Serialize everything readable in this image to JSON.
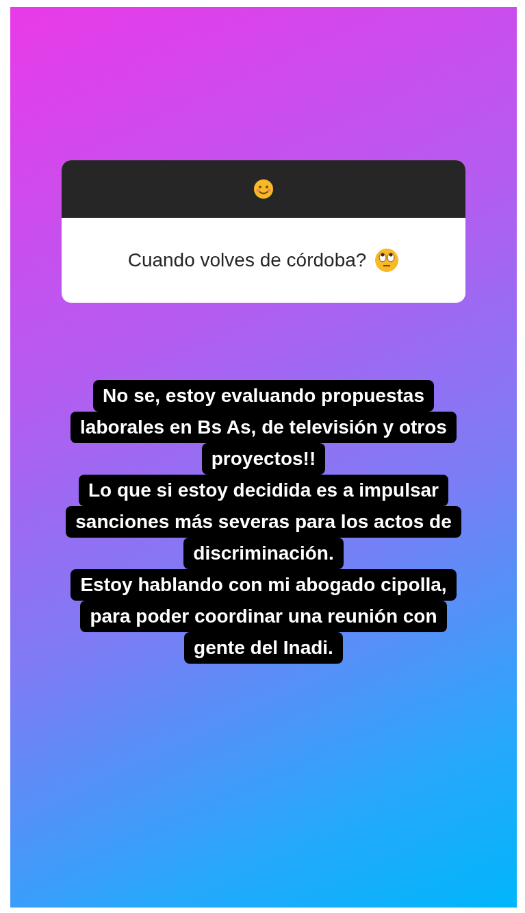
{
  "question_card": {
    "question": "Cuando volves de córdoba?"
  },
  "answer": {
    "paragraphs": [
      {
        "lines": [
          "No se, estoy evaluando propuestas",
          "laborales en Bs As, de televisión y otros",
          "proyectos!!"
        ]
      },
      {
        "lines": [
          "Lo que si estoy decidida es a impulsar",
          "sanciones más severas para los actos de",
          "discriminación."
        ]
      },
      {
        "lines": [
          "Estoy hablando con mi abogado cipolla,",
          "para poder coordinar una reunión con",
          "gente del Inadi."
        ]
      }
    ]
  }
}
